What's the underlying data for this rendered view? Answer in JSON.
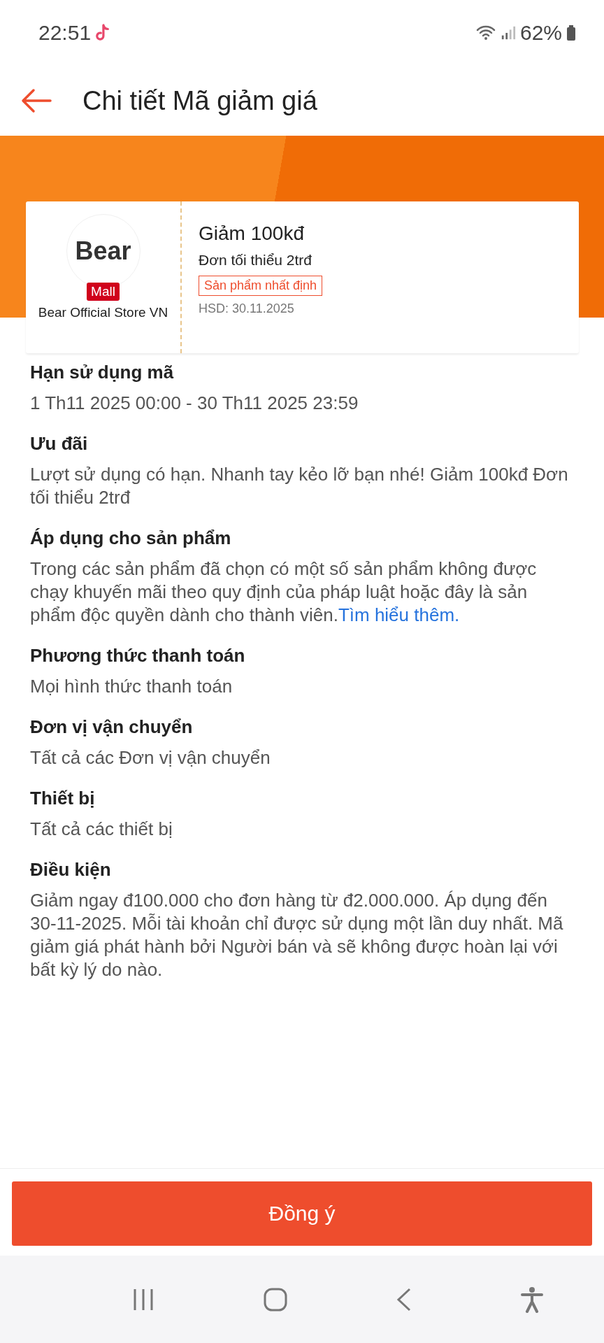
{
  "status_bar": {
    "time": "22:51",
    "battery": "62%"
  },
  "header": {
    "title": "Chi tiết Mã giảm giá"
  },
  "voucher": {
    "logo": "Bear",
    "badge": "Mall",
    "shop": "Bear Official Store VN",
    "title": "Giảm 100kđ",
    "min_order": "Đơn tối thiểu 2trđ",
    "tag": "Sản phẩm nhất định",
    "expiry": "HSD: 30.11.2025"
  },
  "sections": [
    {
      "heading": "Hạn sử dụng mã",
      "text": "1 Th11 2025 00:00 - 30 Th11 2025 23:59"
    },
    {
      "heading": "Ưu đãi",
      "text": "Lượt sử dụng có hạn. Nhanh tay kẻo lỡ bạn nhé! Giảm 100kđ Đơn tối thiểu 2trđ"
    },
    {
      "heading": "Áp dụng cho sản phẩm",
      "text": "Trong các sản phẩm đã chọn có một số sản phẩm không được chạy khuyến mãi theo quy định của pháp luật hoặc đây là sản phẩm độc quyền dành cho thành viên.",
      "link": "Tìm hiểu thêm."
    },
    {
      "heading": "Phương thức thanh toán",
      "text": "Mọi hình thức thanh toán"
    },
    {
      "heading": "Đơn vị vận chuyển",
      "text": "Tất cả các Đơn vị vận chuyển"
    },
    {
      "heading": "Thiết bị",
      "text": "Tất cả các thiết bị"
    },
    {
      "heading": "Điều kiện",
      "text": "Giảm ngay đ100.000 cho đơn hàng từ đ2.000.000. Áp dụng đến 30-11-2025. Mỗi tài khoản chỉ được sử dụng một lần duy nhất. Mã giảm giá phát hành bởi Người bán và sẽ không được hoàn lại với bất kỳ lý do nào."
    }
  ],
  "button": "Đồng ý"
}
